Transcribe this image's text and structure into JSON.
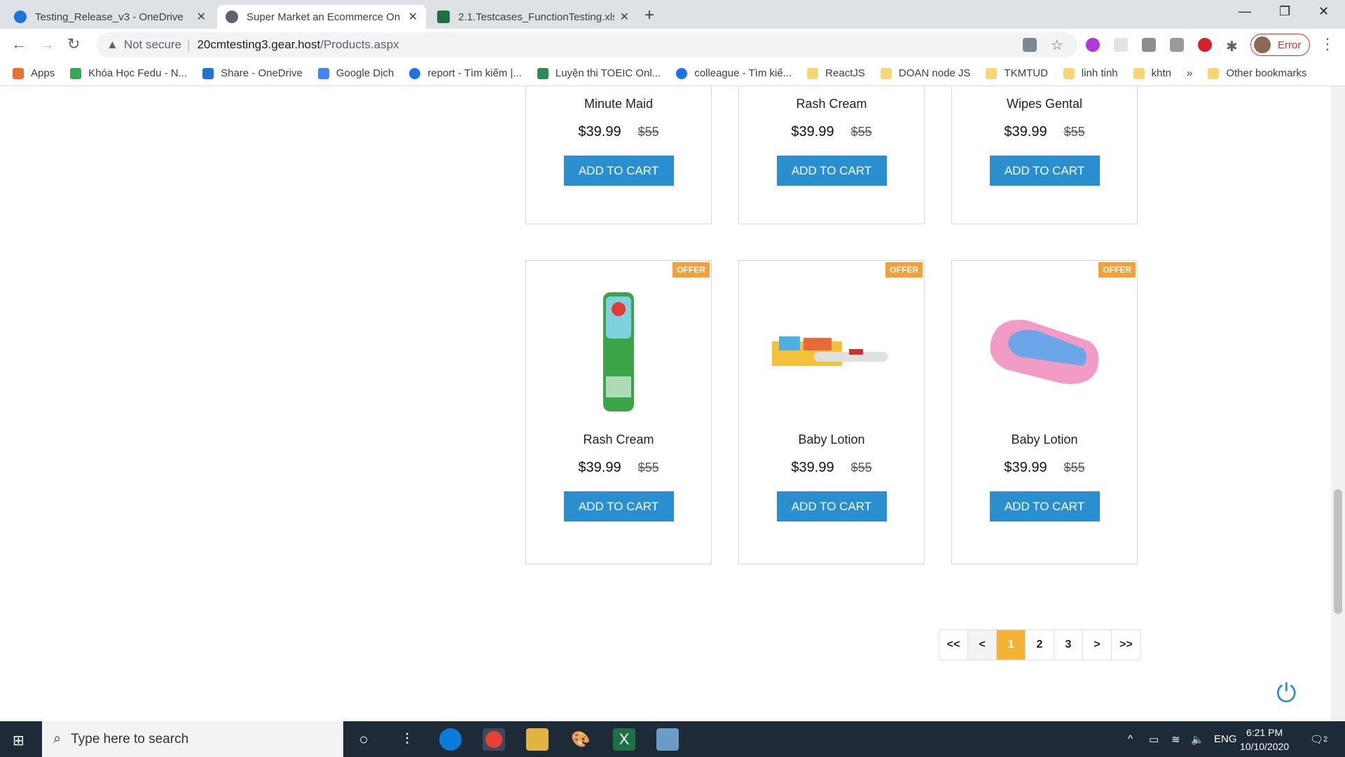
{
  "browser": {
    "tabs": [
      {
        "label": "Testing_Release_v3 - OneDrive",
        "icon": "onedrive-icon"
      },
      {
        "label": "Super Market an Ecommerce On",
        "icon": "globe-icon"
      },
      {
        "label": "2.1.Testcases_FunctionTesting.xls",
        "icon": "excel-icon"
      }
    ],
    "address": {
      "security": "Not secure",
      "host": "20cmtesting3.gear.host",
      "path": "/Products.aspx"
    },
    "profile_label": "Error",
    "bookmarks": [
      {
        "label": "Apps",
        "icon": "apps-grid-icon"
      },
      {
        "label": "Khóa Học Fedu - N...",
        "icon": "drive-icon"
      },
      {
        "label": "Share - OneDrive",
        "icon": "onedrive-icon"
      },
      {
        "label": "Google Dịch",
        "icon": "translate-icon"
      },
      {
        "label": "report - Tìm kiếm |...",
        "icon": "compass-icon"
      },
      {
        "label": "Luyện thi TOEIC Onl...",
        "icon": "toeic-icon"
      },
      {
        "label": "colleague - Tìm kiế...",
        "icon": "compass-icon"
      },
      {
        "label": "ReactJS",
        "icon": "folder-icon"
      },
      {
        "label": "DOAN node JS",
        "icon": "folder-icon"
      },
      {
        "label": "TKMTUD",
        "icon": "folder-icon"
      },
      {
        "label": "linh tinh",
        "icon": "folder-icon"
      },
      {
        "label": "khtn",
        "icon": "folder-icon"
      }
    ],
    "more": "»",
    "other_bookmarks": "Other bookmarks"
  },
  "products_row1": [
    {
      "name": "Minute Maid",
      "price": "$39.99",
      "old_price": "$55",
      "button": "ADD TO CART"
    },
    {
      "name": "Rash Cream",
      "price": "$39.99",
      "old_price": "$55",
      "button": "ADD TO CART"
    },
    {
      "name": "Wipes Gental",
      "price": "$39.99",
      "old_price": "$55",
      "button": "ADD TO CART"
    }
  ],
  "products_row2": [
    {
      "name": "Rash Cream",
      "price": "$39.99",
      "old_price": "$55",
      "button": "ADD TO CART",
      "badge": "OFFER"
    },
    {
      "name": "Baby Lotion",
      "price": "$39.99",
      "old_price": "$55",
      "button": "ADD TO CART",
      "badge": "OFFER"
    },
    {
      "name": "Baby Lotion",
      "price": "$39.99",
      "old_price": "$55",
      "button": "ADD TO CART",
      "badge": "OFFER"
    }
  ],
  "pagination": [
    "<<",
    "<",
    "1",
    "2",
    "3",
    ">",
    ">>"
  ],
  "pagination_active": "1",
  "taskbar": {
    "search_placeholder": "Type here to search",
    "language": "ENG",
    "time": "6:21 PM",
    "date": "10/10/2020",
    "notifications": "2"
  },
  "colors": {
    "accent": "#2a8fcf",
    "offer": "#f3a13a",
    "active_page": "#f5b335"
  }
}
